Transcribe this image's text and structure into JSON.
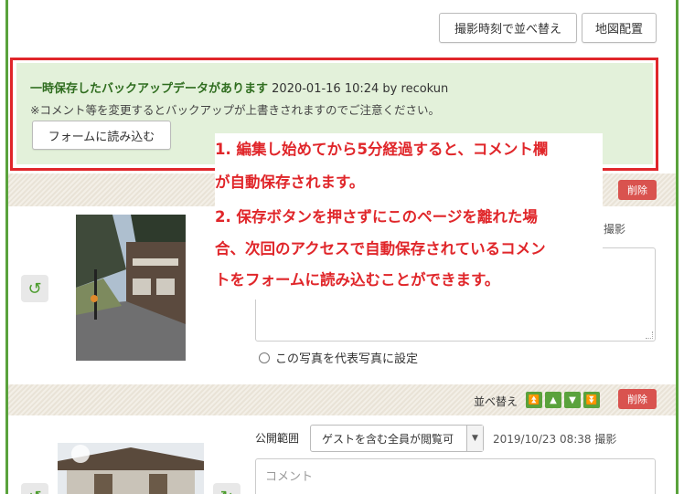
{
  "toolbar": {
    "sort_by_time": "撮影時刻で並べ替え",
    "map_layout": "地図配置"
  },
  "backup": {
    "title": "一時保存したバックアップデータがあります",
    "meta": "2020-01-16 10:24 by recokun",
    "note": "※コメント等を変更するとバックアップが上書きされますのでご注意ください。",
    "load_button": "フォームに読み込む"
  },
  "annotation": {
    "lines": [
      "1. 編集し始めてから5分経過すると、コメント欄",
      "が自動保存されます。",
      "2. 保存ボタンを押さずにこのページを離れた場",
      "合、次回のアクセスで自動保存されているコメン",
      "トをフォームに読み込むことができます。"
    ]
  },
  "photo1": {
    "delete": "削除",
    "taken_suffix": "撮影",
    "rep_photo_label": "この写真を代表写真に設定"
  },
  "photo2": {
    "sort_label": "並べ替え",
    "delete": "削除",
    "scope_label": "公開範囲",
    "scope_value": "ゲストを含む全員が閲覧可",
    "taken": "2019/10/23 08:38 撮影",
    "comment_placeholder": "コメント"
  },
  "colors": {
    "accent_green": "#5aa23c",
    "highlight_red": "#e0262a",
    "backup_bg": "#e3f1da",
    "delete_red": "#d9534f"
  }
}
